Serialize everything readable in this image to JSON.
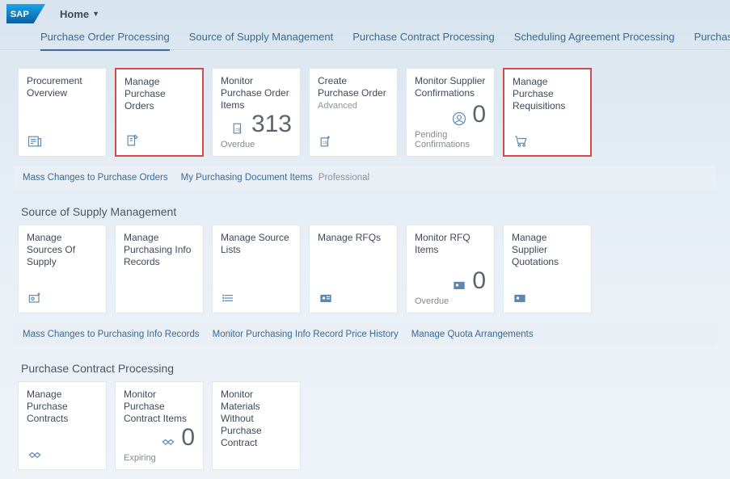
{
  "header": {
    "home_label": "Home"
  },
  "tabs": [
    "Purchase Order Processing",
    "Source of Supply Management",
    "Purchase Contract Processing",
    "Scheduling Agreement Processing",
    "Purchase Requisition P"
  ],
  "section1": {
    "tiles": {
      "procurement_overview": "Procurement Overview",
      "manage_po": "Manage Purchase Orders",
      "monitor_po_items": {
        "title": "Monitor Purchase Order Items",
        "value": "313",
        "footer": "Overdue"
      },
      "create_po": {
        "title": "Create Purchase Order",
        "sub": "Advanced"
      },
      "monitor_supplier_conf": {
        "title": "Monitor Supplier Confirmations",
        "value": "0",
        "footer": "Pending Confirmations"
      },
      "manage_pr": "Manage Purchase Requisitions"
    },
    "links": {
      "mass_changes_po": "Mass Changes to Purchase Orders",
      "my_purch_doc_items": "My Purchasing Document Items",
      "professional": "Professional"
    }
  },
  "section2": {
    "title": "Source of Supply Management",
    "tiles": {
      "manage_sources": "Manage Sources Of Supply",
      "manage_pir": "Manage Purchasing Info Records",
      "manage_source_lists": "Manage Source Lists",
      "manage_rfqs": "Manage RFQs",
      "monitor_rfq_items": {
        "title": "Monitor RFQ Items",
        "value": "0",
        "footer": "Overdue"
      },
      "manage_supp_quot": "Manage Supplier Quotations"
    },
    "links": {
      "mass_changes_pir": "Mass Changes to Purchasing Info Records",
      "monitor_pir_history": "Monitor Purchasing Info Record Price History",
      "manage_quota": "Manage Quota Arrangements"
    }
  },
  "section3": {
    "title": "Purchase Contract Processing",
    "tiles": {
      "manage_pc": "Manage Purchase Contracts",
      "monitor_pc_items": {
        "title": "Monitor Purchase Contract Items",
        "value": "0",
        "footer": "Expiring"
      },
      "monitor_mat_wo_pc": "Monitor Materials Without Purchase Contract"
    }
  }
}
